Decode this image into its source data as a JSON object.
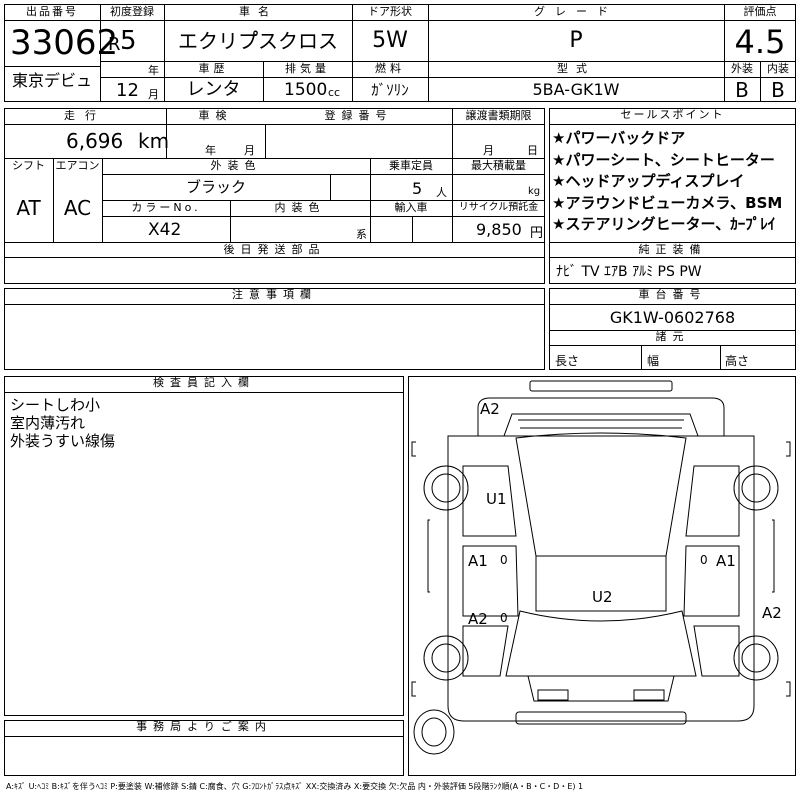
{
  "top": {
    "lot_label": "出品番号",
    "lot_number": "33062",
    "first_reg_label": "初度登録",
    "era": "R",
    "year": "5",
    "year_unit": "年",
    "month": "12",
    "month_unit": "月",
    "name_label": "車名",
    "name": "エクリプ゚スクロス",
    "door_label": "ドア形状",
    "door": "5W",
    "grade_label": "グレード",
    "grade": "P",
    "score_label": "評価点",
    "score": "4.5",
    "venue": "東京デビュ",
    "history_label": "車歴",
    "history": "レンタ",
    "disp_label": "排気量",
    "disp": "1500",
    "disp_unit": "cc",
    "fuel_label": "燃料",
    "fuel": "ｶﾞｿﾘﾝ",
    "model_label": "型式",
    "model": "5BA-GK1W",
    "ext_label": "外装",
    "ext": "B",
    "int_label": "内装",
    "int": "B"
  },
  "second": {
    "mileage_label": "走行",
    "mileage": "6,696",
    "mileage_unit": "km",
    "inspection_label": "車検",
    "insp_year_unit": "年",
    "insp_month_unit": "月",
    "reg_label": "登録番号",
    "transfer_label": "譲渡書類期限",
    "transfer_month_unit": "月",
    "transfer_day_unit": "日",
    "shift_label": "シフト",
    "shift": "AT",
    "ac_label": "エアコン",
    "ac": "AC",
    "color_label": "外装色",
    "color": "ブラック",
    "capacity_label": "乗車定員",
    "capacity": "5",
    "capacity_unit": "人",
    "load_label": "最大積載量",
    "load_unit": "kg",
    "color_no_label": "カラーNo.",
    "color_no": "X42",
    "int_color_label": "内装色",
    "int_color_unit": "系",
    "import_label": "輸入車",
    "recycle_label": "リサイクル預託金",
    "recycle": "9,850",
    "recycle_unit": "円",
    "later_label": "後日発送部品"
  },
  "sales": {
    "label": "セールスポイント",
    "points": [
      "★パワーバックドア",
      "★パワーシート、シートヒーター",
      "★ヘッドアップディスプレイ",
      "★アラウンドビューカメラ、BSM",
      "★ステアリングヒーター、ｶｰﾌﾟﾚｲ"
    ]
  },
  "equipment": {
    "label": "純正装備",
    "value": "ﾅﾋﾞ TV ｴｱB ｱﾙﾐ PS PW"
  },
  "notes": {
    "label": "注意事項欄"
  },
  "chassis": {
    "label": "車台番号",
    "value": "GK1W-0602768"
  },
  "dims": {
    "label": "諸元",
    "length": "長さ",
    "width": "幅",
    "height": "高さ"
  },
  "inspector": {
    "label": "検査員記入欄",
    "lines": [
      "シートしわ小",
      "室内薄汚れ",
      "外装うすい線傷"
    ]
  },
  "office": {
    "label": "事務局よりご案内"
  },
  "diagram": {
    "marks": [
      "A2",
      "U1",
      "A1",
      "A1",
      "A2",
      "U2",
      "A2"
    ],
    "zeros": [
      "0",
      "0",
      "0"
    ]
  },
  "legend": "A:ｷｽﾞ U:ﾍｺﾐ B:ｷｽﾞを伴うﾍｺﾐ P:要塗装 W:補修跡 S:錆 C:腐食、穴 G:ﾌﾛﾝﾄｶﾞﾗｽ点ｷｽﾞ XX:交換済み X:要交換 欠:欠品 内・外装評価 5段階ﾗﾝｸ順(A・B・C・D・E) 1"
}
